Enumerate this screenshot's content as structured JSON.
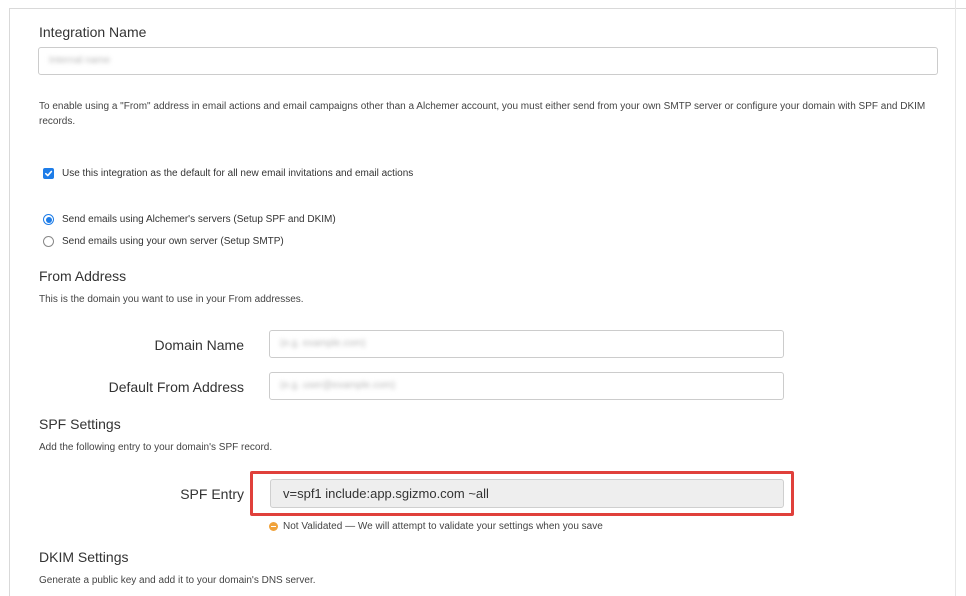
{
  "integration": {
    "title": "Integration Name",
    "name_placeholder": "Internal name"
  },
  "info_text": "To enable using a \"From\" address in email actions and email campaigns other than a Alchemer account, you must either send from your own SMTP server or configure your domain with SPF and DKIM records.",
  "default_checkbox": {
    "checked": true,
    "label": "Use this integration as the default for all new email invitations and email actions"
  },
  "send_options": [
    {
      "label": "Send emails using Alchemer's servers (Setup SPF and DKIM)",
      "selected": true
    },
    {
      "label": "Send emails using your own server (Setup SMTP)",
      "selected": false
    }
  ],
  "from_address": {
    "title": "From Address",
    "description": "This is the domain you want to use in your From addresses.",
    "domain_label": "Domain Name",
    "domain_placeholder": "(e.g. example.com)",
    "default_from_label": "Default From Address",
    "default_from_placeholder": "(e.g. user@example.com)"
  },
  "spf": {
    "title": "SPF Settings",
    "description": "Add the following entry to your domain's SPF record.",
    "entry_label": "SPF Entry",
    "entry_value": "v=spf1 include:app.sgizmo.com ~all",
    "status": "Not Validated — We will attempt to validate your settings when you save"
  },
  "dkim": {
    "title": "DKIM Settings",
    "description": "Generate a public key and add it to your domain's DNS server."
  },
  "colors": {
    "accent": "#1e7de8",
    "highlight": "#e0403b",
    "warning": "#f0a23a"
  }
}
